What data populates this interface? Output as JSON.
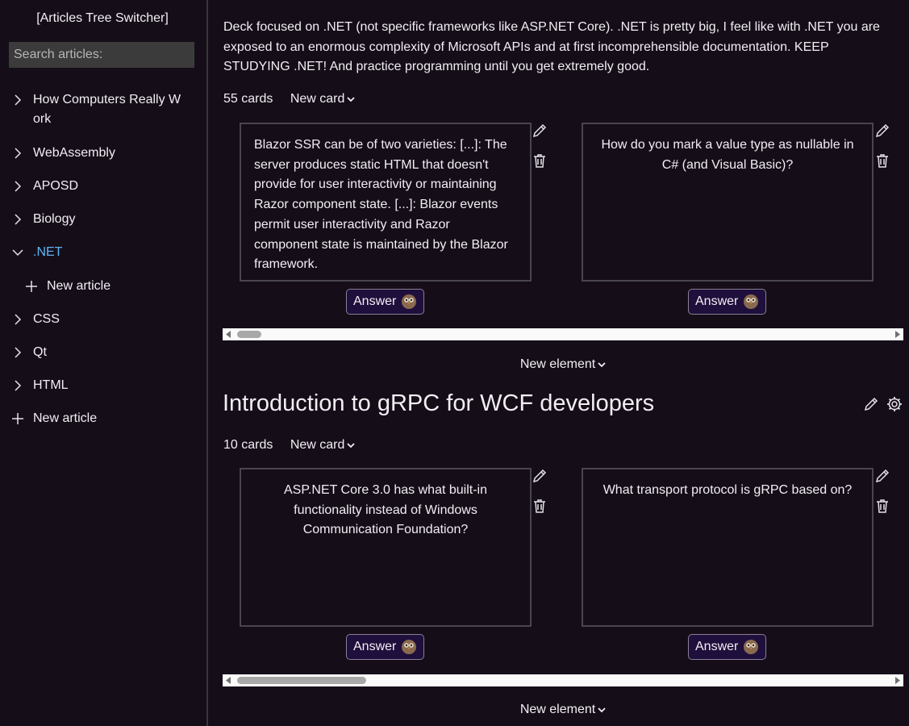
{
  "sidebar": {
    "title": "[Articles Tree Switcher]",
    "search_placeholder": "Search articles:",
    "items": [
      {
        "label": "How Computers Really Work",
        "expanded": false
      },
      {
        "label": "WebAssembly",
        "expanded": false
      },
      {
        "label": "APOSD",
        "expanded": false
      },
      {
        "label": "Biology",
        "expanded": false
      },
      {
        "label": ".NET",
        "expanded": true
      },
      {
        "label": "CSS",
        "expanded": false
      },
      {
        "label": "Qt",
        "expanded": false
      },
      {
        "label": "HTML",
        "expanded": false
      }
    ],
    "sub_new_article": "New article",
    "new_article": "New article",
    "active_color": "#5fb5f5"
  },
  "main": {
    "description": "Deck focused on .NET (not specific frameworks like ASP.NET Core). .NET is pretty big, I feel like with .NET you are exposed to an enormous complexity of Microsoft APIs and at first incomprehensible documentation. KEEP STUDYING .NET! And practice programming until you get extremely good.",
    "deck1": {
      "count": "55 cards",
      "new_card": "New card",
      "cards": [
        {
          "text": "Blazor SSR can be of two varieties: [...]: The server produces static HTML that doesn't provide for user interactivity or maintaining Razor component state. [...]: Blazor events permit user interactivity and Razor component state is maintained by the Blazor framework."
        },
        {
          "text": "How do you mark a value type as nullable in C# (and Visual Basic)?"
        }
      ],
      "answer": "Answer",
      "new_element": "New element"
    },
    "section2": {
      "title": "Introduction to gRPC for WCF developers",
      "count": "10 cards",
      "new_card": "New card",
      "cards": [
        {
          "text": "ASP.NET Core 3.0 has what built-in functionality instead of Windows Communication Foundation?"
        },
        {
          "text": "What transport protocol is gRPC based on?"
        }
      ],
      "answer": "Answer",
      "new_element": "New element"
    }
  }
}
